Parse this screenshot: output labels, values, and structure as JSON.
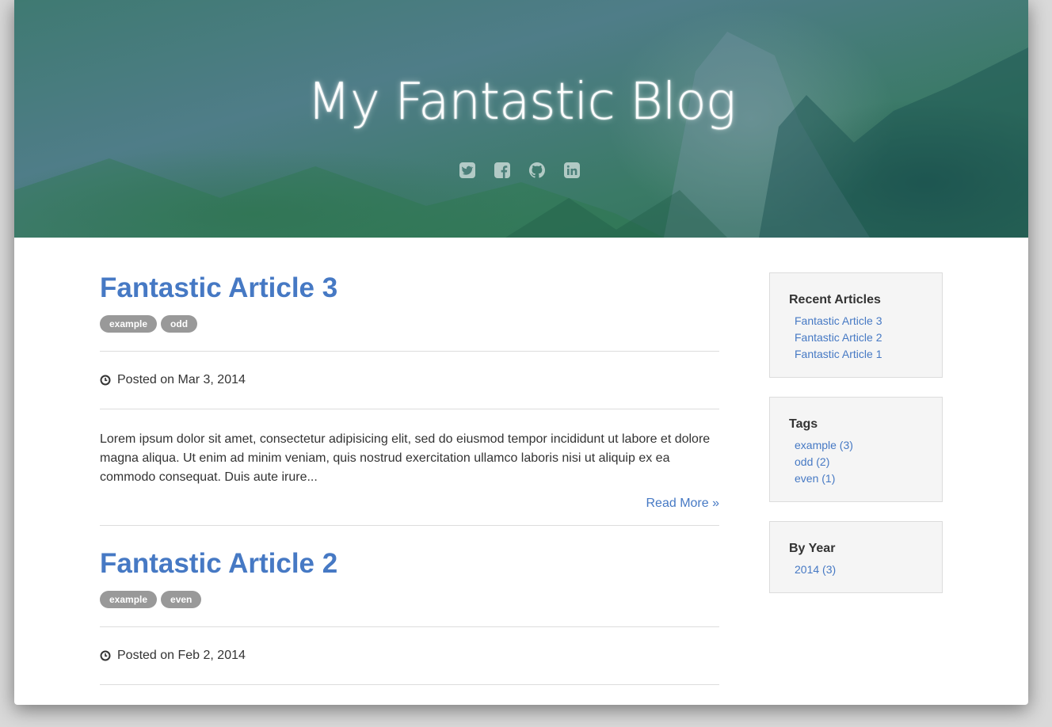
{
  "site": {
    "title": "My Fantastic Blog",
    "social": [
      "twitter-icon",
      "facebook-icon",
      "github-icon",
      "linkedin-icon"
    ]
  },
  "articles": [
    {
      "title": "Fantastic Article 3",
      "tags": [
        "example",
        "odd"
      ],
      "posted": "Posted on Mar 3, 2014",
      "excerpt": "Lorem ipsum dolor sit amet, consectetur adipisicing elit, sed do eiusmod tempor incididunt ut labore et dolore magna aliqua. Ut enim ad minim veniam, quis nostrud exercitation ullamco laboris nisi ut aliquip ex ea commodo consequat. Duis aute irure...",
      "read_more": "Read More »"
    },
    {
      "title": "Fantastic Article 2",
      "tags": [
        "example",
        "even"
      ],
      "posted": "Posted on Feb 2, 2014"
    }
  ],
  "sidebar": {
    "recent": {
      "heading": "Recent Articles",
      "items": [
        "Fantastic Article 3",
        "Fantastic Article 2",
        "Fantastic Article 1"
      ]
    },
    "tags": {
      "heading": "Tags",
      "items": [
        "example (3)",
        "odd (2)",
        "even (1)"
      ]
    },
    "by_year": {
      "heading": "By Year",
      "items": [
        "2014 (3)"
      ]
    }
  },
  "colors": {
    "link": "#4679c4",
    "tag_bg": "#999999"
  }
}
